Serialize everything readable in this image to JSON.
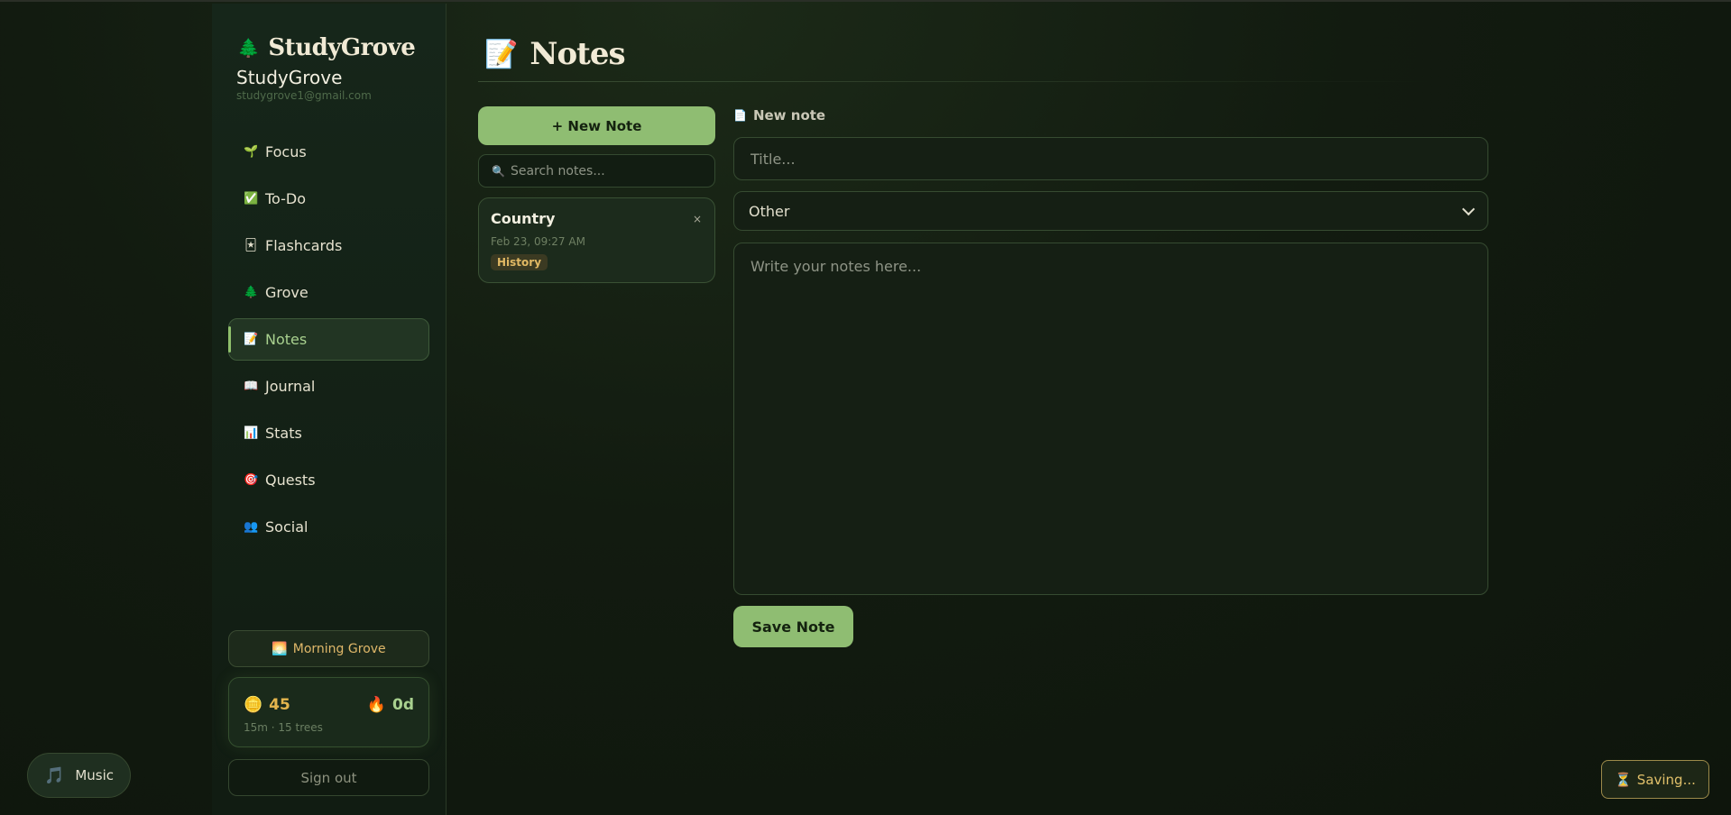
{
  "brand": {
    "logo_icon": "🌲",
    "name": "StudyGrove"
  },
  "user": {
    "name": "StudyGrove",
    "email": "studygrove1@gmail.com"
  },
  "nav": [
    {
      "icon": "🌱",
      "label": "Focus"
    },
    {
      "icon": "✅",
      "label": "To-Do"
    },
    {
      "icon": "🃏",
      "label": "Flashcards"
    },
    {
      "icon": "🌲",
      "label": "Grove"
    },
    {
      "icon": "📝",
      "label": "Notes",
      "active": true
    },
    {
      "icon": "📖",
      "label": "Journal"
    },
    {
      "icon": "📊",
      "label": "Stats"
    },
    {
      "icon": "🎯",
      "label": "Quests"
    },
    {
      "icon": "👥",
      "label": "Social"
    }
  ],
  "theme": {
    "icon": "🌅",
    "label": "Morning Grove"
  },
  "stats": {
    "coins_icon": "🪙",
    "coins": "45",
    "streak_icon": "🔥",
    "streak": "0d",
    "subtitle": "15m · 15 trees"
  },
  "sign_out": "Sign out",
  "music": {
    "icon": "🎵",
    "label": "Music"
  },
  "page": {
    "icon": "📝",
    "title": "Notes"
  },
  "notes_panel": {
    "new_note_label": "+ New Note",
    "search_icon": "🔍",
    "search_placeholder": "Search notes...",
    "notes": [
      {
        "title": "Country",
        "date": "Feb 23, 09:27 AM",
        "tag": "History",
        "close": "×"
      }
    ]
  },
  "editor": {
    "label_icon": "📄",
    "label": "New note",
    "title_placeholder": "Title...",
    "category": "Other",
    "body_placeholder": "Write your notes here...",
    "save_label": "Save Note"
  },
  "status": {
    "icon": "⏳",
    "label": "Saving..."
  },
  "colors": {
    "accent": "#8fbd72",
    "gold": "#e5b64d",
    "background": "#121b10"
  }
}
